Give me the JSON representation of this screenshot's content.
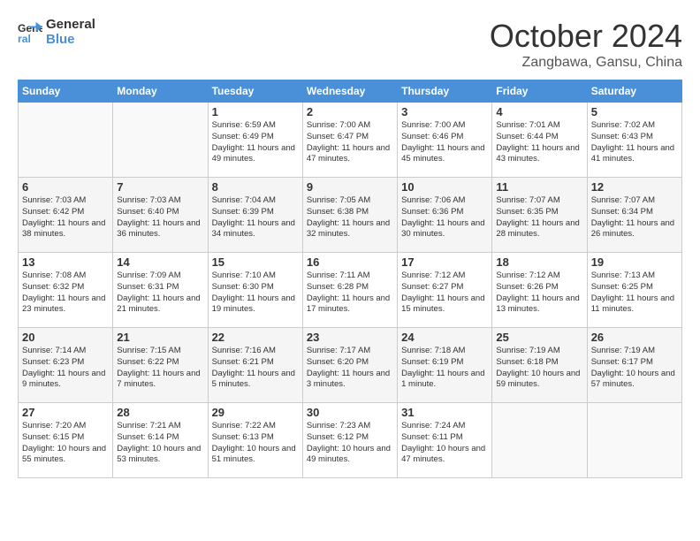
{
  "header": {
    "logo_line1": "General",
    "logo_line2": "Blue",
    "month": "October 2024",
    "location": "Zangbawa, Gansu, China"
  },
  "weekdays": [
    "Sunday",
    "Monday",
    "Tuesday",
    "Wednesday",
    "Thursday",
    "Friday",
    "Saturday"
  ],
  "weeks": [
    [
      {
        "day": "",
        "sunrise": "",
        "sunset": "",
        "daylight": ""
      },
      {
        "day": "",
        "sunrise": "",
        "sunset": "",
        "daylight": ""
      },
      {
        "day": "1",
        "sunrise": "Sunrise: 6:59 AM",
        "sunset": "Sunset: 6:49 PM",
        "daylight": "Daylight: 11 hours and 49 minutes."
      },
      {
        "day": "2",
        "sunrise": "Sunrise: 7:00 AM",
        "sunset": "Sunset: 6:47 PM",
        "daylight": "Daylight: 11 hours and 47 minutes."
      },
      {
        "day": "3",
        "sunrise": "Sunrise: 7:00 AM",
        "sunset": "Sunset: 6:46 PM",
        "daylight": "Daylight: 11 hours and 45 minutes."
      },
      {
        "day": "4",
        "sunrise": "Sunrise: 7:01 AM",
        "sunset": "Sunset: 6:44 PM",
        "daylight": "Daylight: 11 hours and 43 minutes."
      },
      {
        "day": "5",
        "sunrise": "Sunrise: 7:02 AM",
        "sunset": "Sunset: 6:43 PM",
        "daylight": "Daylight: 11 hours and 41 minutes."
      }
    ],
    [
      {
        "day": "6",
        "sunrise": "Sunrise: 7:03 AM",
        "sunset": "Sunset: 6:42 PM",
        "daylight": "Daylight: 11 hours and 38 minutes."
      },
      {
        "day": "7",
        "sunrise": "Sunrise: 7:03 AM",
        "sunset": "Sunset: 6:40 PM",
        "daylight": "Daylight: 11 hours and 36 minutes."
      },
      {
        "day": "8",
        "sunrise": "Sunrise: 7:04 AM",
        "sunset": "Sunset: 6:39 PM",
        "daylight": "Daylight: 11 hours and 34 minutes."
      },
      {
        "day": "9",
        "sunrise": "Sunrise: 7:05 AM",
        "sunset": "Sunset: 6:38 PM",
        "daylight": "Daylight: 11 hours and 32 minutes."
      },
      {
        "day": "10",
        "sunrise": "Sunrise: 7:06 AM",
        "sunset": "Sunset: 6:36 PM",
        "daylight": "Daylight: 11 hours and 30 minutes."
      },
      {
        "day": "11",
        "sunrise": "Sunrise: 7:07 AM",
        "sunset": "Sunset: 6:35 PM",
        "daylight": "Daylight: 11 hours and 28 minutes."
      },
      {
        "day": "12",
        "sunrise": "Sunrise: 7:07 AM",
        "sunset": "Sunset: 6:34 PM",
        "daylight": "Daylight: 11 hours and 26 minutes."
      }
    ],
    [
      {
        "day": "13",
        "sunrise": "Sunrise: 7:08 AM",
        "sunset": "Sunset: 6:32 PM",
        "daylight": "Daylight: 11 hours and 23 minutes."
      },
      {
        "day": "14",
        "sunrise": "Sunrise: 7:09 AM",
        "sunset": "Sunset: 6:31 PM",
        "daylight": "Daylight: 11 hours and 21 minutes."
      },
      {
        "day": "15",
        "sunrise": "Sunrise: 7:10 AM",
        "sunset": "Sunset: 6:30 PM",
        "daylight": "Daylight: 11 hours and 19 minutes."
      },
      {
        "day": "16",
        "sunrise": "Sunrise: 7:11 AM",
        "sunset": "Sunset: 6:28 PM",
        "daylight": "Daylight: 11 hours and 17 minutes."
      },
      {
        "day": "17",
        "sunrise": "Sunrise: 7:12 AM",
        "sunset": "Sunset: 6:27 PM",
        "daylight": "Daylight: 11 hours and 15 minutes."
      },
      {
        "day": "18",
        "sunrise": "Sunrise: 7:12 AM",
        "sunset": "Sunset: 6:26 PM",
        "daylight": "Daylight: 11 hours and 13 minutes."
      },
      {
        "day": "19",
        "sunrise": "Sunrise: 7:13 AM",
        "sunset": "Sunset: 6:25 PM",
        "daylight": "Daylight: 11 hours and 11 minutes."
      }
    ],
    [
      {
        "day": "20",
        "sunrise": "Sunrise: 7:14 AM",
        "sunset": "Sunset: 6:23 PM",
        "daylight": "Daylight: 11 hours and 9 minutes."
      },
      {
        "day": "21",
        "sunrise": "Sunrise: 7:15 AM",
        "sunset": "Sunset: 6:22 PM",
        "daylight": "Daylight: 11 hours and 7 minutes."
      },
      {
        "day": "22",
        "sunrise": "Sunrise: 7:16 AM",
        "sunset": "Sunset: 6:21 PM",
        "daylight": "Daylight: 11 hours and 5 minutes."
      },
      {
        "day": "23",
        "sunrise": "Sunrise: 7:17 AM",
        "sunset": "Sunset: 6:20 PM",
        "daylight": "Daylight: 11 hours and 3 minutes."
      },
      {
        "day": "24",
        "sunrise": "Sunrise: 7:18 AM",
        "sunset": "Sunset: 6:19 PM",
        "daylight": "Daylight: 11 hours and 1 minute."
      },
      {
        "day": "25",
        "sunrise": "Sunrise: 7:19 AM",
        "sunset": "Sunset: 6:18 PM",
        "daylight": "Daylight: 10 hours and 59 minutes."
      },
      {
        "day": "26",
        "sunrise": "Sunrise: 7:19 AM",
        "sunset": "Sunset: 6:17 PM",
        "daylight": "Daylight: 10 hours and 57 minutes."
      }
    ],
    [
      {
        "day": "27",
        "sunrise": "Sunrise: 7:20 AM",
        "sunset": "Sunset: 6:15 PM",
        "daylight": "Daylight: 10 hours and 55 minutes."
      },
      {
        "day": "28",
        "sunrise": "Sunrise: 7:21 AM",
        "sunset": "Sunset: 6:14 PM",
        "daylight": "Daylight: 10 hours and 53 minutes."
      },
      {
        "day": "29",
        "sunrise": "Sunrise: 7:22 AM",
        "sunset": "Sunset: 6:13 PM",
        "daylight": "Daylight: 10 hours and 51 minutes."
      },
      {
        "day": "30",
        "sunrise": "Sunrise: 7:23 AM",
        "sunset": "Sunset: 6:12 PM",
        "daylight": "Daylight: 10 hours and 49 minutes."
      },
      {
        "day": "31",
        "sunrise": "Sunrise: 7:24 AM",
        "sunset": "Sunset: 6:11 PM",
        "daylight": "Daylight: 10 hours and 47 minutes."
      },
      {
        "day": "",
        "sunrise": "",
        "sunset": "",
        "daylight": ""
      },
      {
        "day": "",
        "sunrise": "",
        "sunset": "",
        "daylight": ""
      }
    ]
  ]
}
